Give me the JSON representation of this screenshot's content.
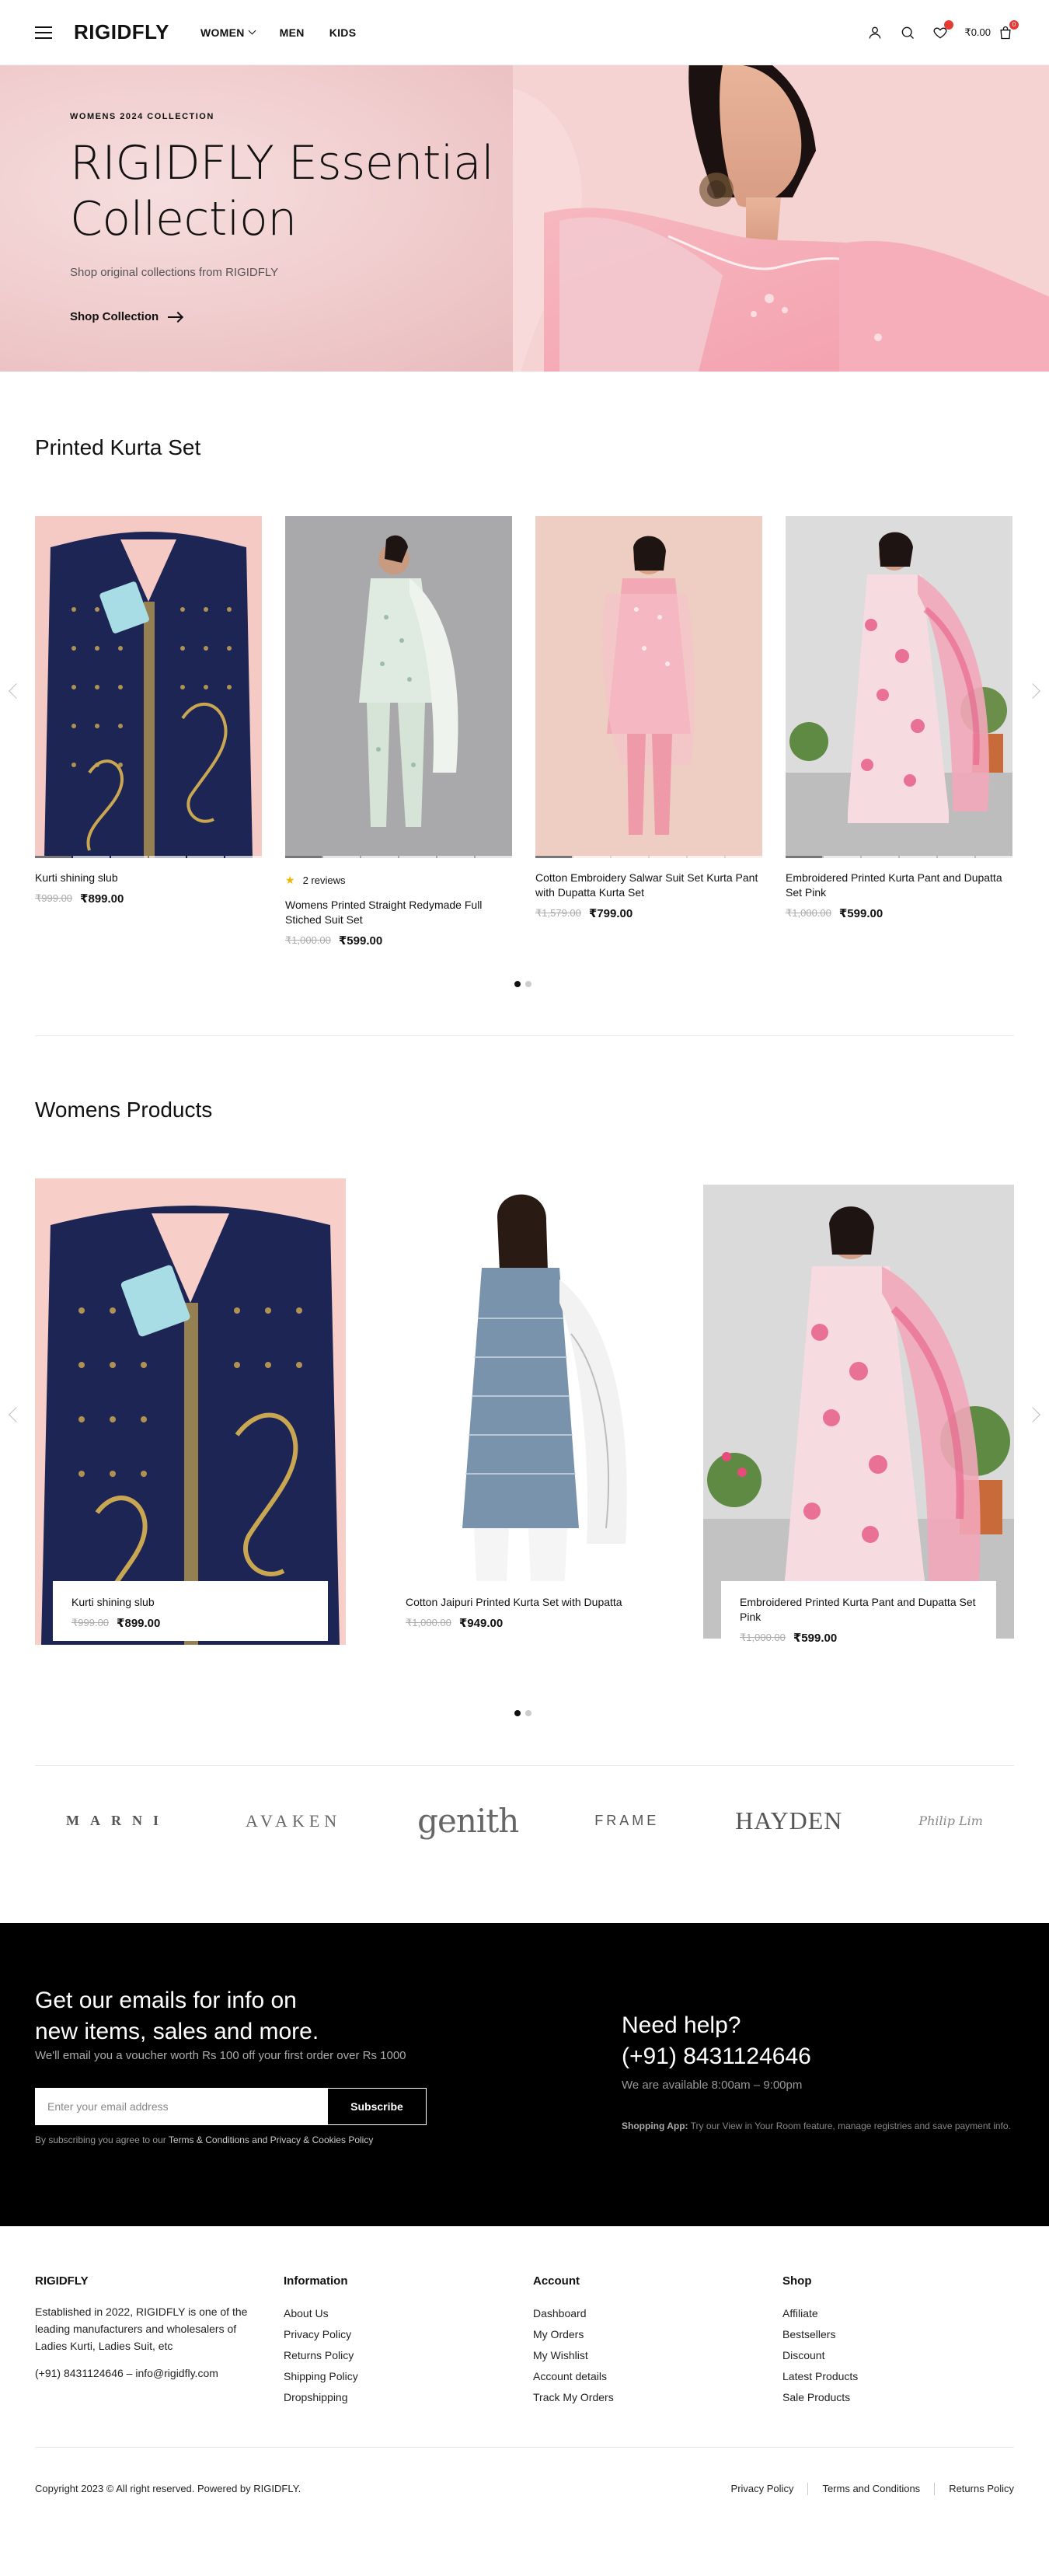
{
  "header": {
    "logo": "RIGIDFLY",
    "nav": [
      {
        "label": "WOMEN",
        "has_dropdown": true
      },
      {
        "label": "MEN",
        "has_dropdown": false
      },
      {
        "label": "KIDS",
        "has_dropdown": false
      }
    ],
    "wishlist_count": "",
    "cart_count": "0",
    "cart_total": "₹0.00"
  },
  "hero": {
    "eyebrow": "WOMENS 2024 COLLECTION",
    "title_line1": "RIGIDFLY Essential",
    "title_line2": "Collection",
    "subtitle": "Shop original collections from RIGIDFLY",
    "cta": "Shop Collection"
  },
  "section1": {
    "title": "Printed Kurta Set",
    "products": [
      {
        "name": "Kurti shining slub",
        "old_price": "₹999.00",
        "price": "₹899.00",
        "rating_text": ""
      },
      {
        "name": "Womens Printed Straight Redymade Full Stiched Suit Set",
        "old_price": "₹1,000.00",
        "price": "₹599.00",
        "rating_text": "2 reviews"
      },
      {
        "name": "Cotton Embroidery Salwar Suit Set Kurta Pant with Dupatta Kurta Set",
        "old_price": "₹1,579.00",
        "price": "₹799.00",
        "rating_text": ""
      },
      {
        "name": "Embroidered Printed Kurta Pant and Dupatta Set Pink",
        "old_price": "₹1,000.00",
        "price": "₹599.00",
        "rating_text": ""
      }
    ]
  },
  "section2": {
    "title": "Womens Products",
    "products": [
      {
        "name": "Kurti shining slub",
        "old_price": "₹999.00",
        "price": "₹899.00"
      },
      {
        "name": "Cotton Jaipuri Printed Kurta Set with Dupatta",
        "old_price": "₹1,000.00",
        "price": "₹949.00"
      },
      {
        "name": "Embroidered Printed Kurta Pant and Dupatta Set Pink",
        "old_price": "₹1,000.00",
        "price": "₹599.00"
      }
    ]
  },
  "brands": [
    "MARNI",
    "AVAKEN",
    "genith",
    "FRAME",
    "HAYDEN",
    "Philip Lim"
  ],
  "newsletter": {
    "title_line1": "Get our emails for info on",
    "title_line2": "new items, sales and more.",
    "subtitle": "We'll email you a voucher worth Rs 100 off your first order over Rs 1000",
    "placeholder": "Enter your email address",
    "button": "Subscribe",
    "terms_prefix": "By subscribing you agree to our",
    "terms_link": "Terms & Conditions and Privacy & Cookies Policy",
    "help_title_line1": "Need help?",
    "help_title_line2": "(+91) 8431124646",
    "help_hours": "We are available 8:00am – 9:00pm",
    "app_label": "Shopping App:",
    "app_text": "Try our View in Your Room feature, manage registries and save payment info."
  },
  "footer": {
    "brand": "RIGIDFLY",
    "about": "Established in 2022, RIGIDFLY is one of the leading manufacturers and wholesalers of Ladies Kurti, Ladies Suit, etc",
    "contact": "(+91) 8431124646 – info@rigidfly.com",
    "columns": [
      {
        "title": "Information",
        "links": [
          "About Us",
          "Privacy Policy",
          "Returns Policy",
          "Shipping Policy",
          "Dropshipping"
        ]
      },
      {
        "title": "Account",
        "links": [
          "Dashboard",
          "My Orders",
          "My Wishlist",
          "Account details",
          "Track My Orders"
        ]
      },
      {
        "title": "Shop",
        "links": [
          "Affiliate",
          "Bestsellers",
          "Discount",
          "Latest Products",
          "Sale Products"
        ]
      }
    ],
    "copyright": "Copyright 2023 © All right reserved. Powered by RIGIDFLY.",
    "legal": [
      "Privacy Policy",
      "Terms and Conditions",
      "Returns Policy"
    ]
  },
  "colors": {
    "accent": "#e53935",
    "hero_pink": "#f0c6c7",
    "navy_kurti": "#1c2553",
    "pink_suit": "#f2a7b6"
  }
}
